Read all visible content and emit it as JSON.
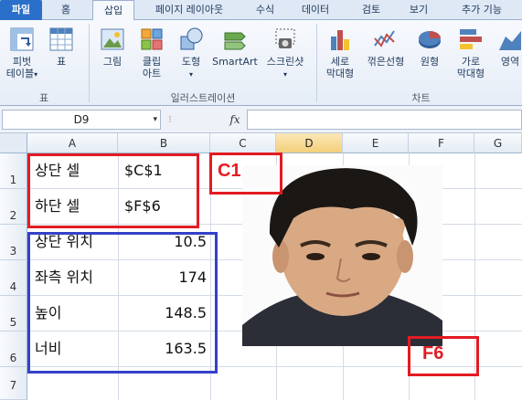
{
  "tabs": [
    "파일",
    "홈",
    "삽입",
    "페이지 레이아웃",
    "수식",
    "데이터",
    "검토",
    "보기",
    "추가 기능"
  ],
  "ribbon": {
    "table_group": {
      "pivot": "피벗\n테이블",
      "pivot_arrow": "▾",
      "table": "표",
      "label": "표"
    },
    "illust_group": {
      "picture": "그림",
      "clipart": "클립\n아트",
      "shapes": "도형",
      "shapes_arrow": "▾",
      "smartart": "SmartArt",
      "screenshot": "스크린샷",
      "screenshot_arrow": "▾",
      "label": "일러스트레이션"
    },
    "chart_group": {
      "column": "세로\n막대형",
      "line": "꺾은선형",
      "pie": "원형",
      "bar": "가로\n막대형",
      "area": "영역",
      "label": "차트"
    }
  },
  "formula_bar": {
    "name_box": "D9",
    "name_arrow": "▾",
    "fx": "fx",
    "separator": "⁝",
    "formula": ""
  },
  "columns": [
    "A",
    "B",
    "C",
    "D",
    "E",
    "F",
    "G"
  ],
  "selected_column": "D",
  "rows": [
    "1",
    "2",
    "3",
    "4",
    "5",
    "6",
    "7"
  ],
  "cells": {
    "A1": "상단 셀",
    "B1": "$C$1",
    "A2": "하단 셀",
    "B2": "$F$6",
    "A3": "상단 위치",
    "B3": "10.5",
    "A4": "좌측 위치",
    "B4": "174",
    "A5": "높이",
    "B5": "148.5",
    "A6": "너비",
    "B6": "163.5"
  },
  "annotations": {
    "top_ref": "C1",
    "bottom_ref": "F6"
  },
  "colors": {
    "red": "#e31b23",
    "blue": "#3540c8",
    "selected_header": "#f3cf7a"
  }
}
